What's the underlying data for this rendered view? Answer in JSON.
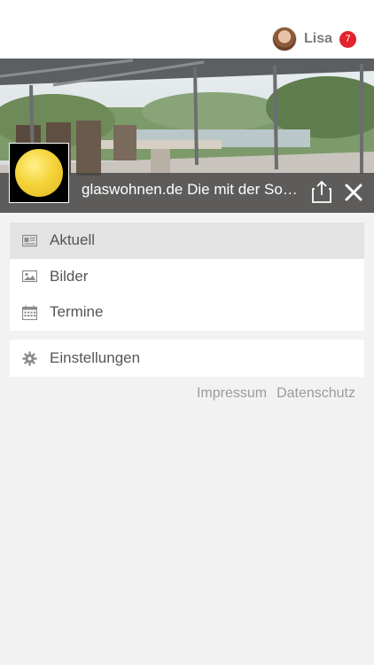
{
  "header": {
    "user_name": "Lisa",
    "notification_count": "7"
  },
  "hero": {
    "title": "glaswohnen.de Die mit der Sonne wohnen"
  },
  "menu": {
    "main_items": [
      {
        "label": "Aktuell",
        "icon": "newspaper-icon",
        "active": true
      },
      {
        "label": "Bilder",
        "icon": "image-icon",
        "active": false
      },
      {
        "label": "Termine",
        "icon": "calendar-icon",
        "active": false
      }
    ],
    "settings_label": "Einstellungen"
  },
  "footer_links": {
    "impressum": "Impressum",
    "datenschutz": "Datenschutz"
  },
  "colors": {
    "badge": "#e2222d",
    "hero_bar": "#464646",
    "logo_yellow": "#f5d43a"
  }
}
